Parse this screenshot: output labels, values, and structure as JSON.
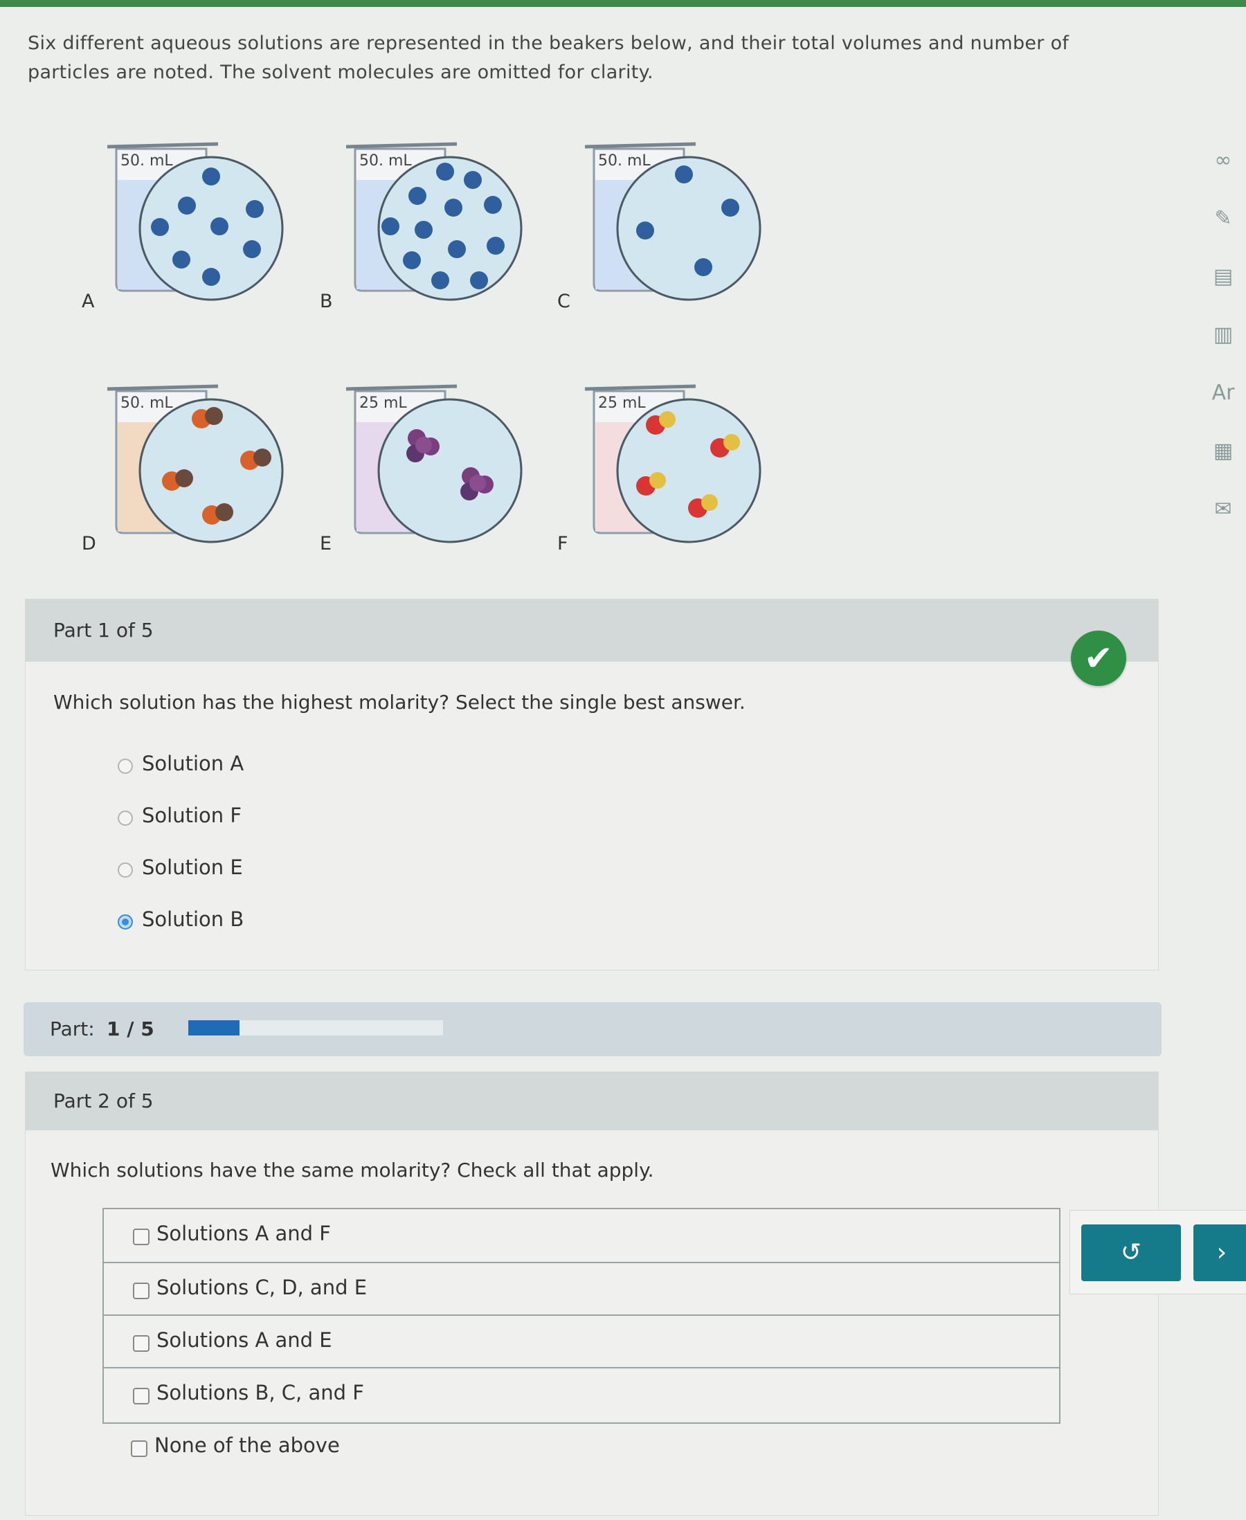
{
  "intro_text": "Six different aqueous solutions are represented in the beakers below, and their total volumes and number of particles are noted. The solvent molecules are omitted for clarity.",
  "beakers": [
    {
      "letter": "A",
      "volume": "50. mL"
    },
    {
      "letter": "B",
      "volume": "50. mL"
    },
    {
      "letter": "C",
      "volume": "50. mL"
    },
    {
      "letter": "D",
      "volume": "50. mL"
    },
    {
      "letter": "E",
      "volume": "25 mL"
    },
    {
      "letter": "F",
      "volume": "25 mL"
    }
  ],
  "side_tools": [
    "infinity-icon",
    "pencil-icon",
    "calculator-icon",
    "chart-icon",
    "periodic-table-icon",
    "grid-icon",
    "mail-icon"
  ],
  "part1": {
    "header": "Part 1 of 5",
    "question": "Which solution has the highest molarity? Select the single best answer.",
    "options": [
      "Solution A",
      "Solution F",
      "Solution E",
      "Solution B"
    ],
    "selected_index": 3,
    "status": "correct"
  },
  "progress": {
    "label": "Part:",
    "value": "1 / 5",
    "fraction": 0.2
  },
  "part2": {
    "header": "Part 2 of 5",
    "question": "Which solutions have the same molarity? Check all that apply.",
    "options": [
      "Solutions A and F",
      "Solutions C, D, and E",
      "Solutions A and E",
      "Solutions B, C, and F"
    ],
    "extra_option": "None of the above"
  },
  "actions": {
    "undo_icon": "undo-icon",
    "next_icon": "next-icon"
  },
  "colors": {
    "topbar": "#3f8a4a",
    "check": "#2f8f45",
    "button": "#157a89",
    "progress": "#1f6cb5"
  }
}
